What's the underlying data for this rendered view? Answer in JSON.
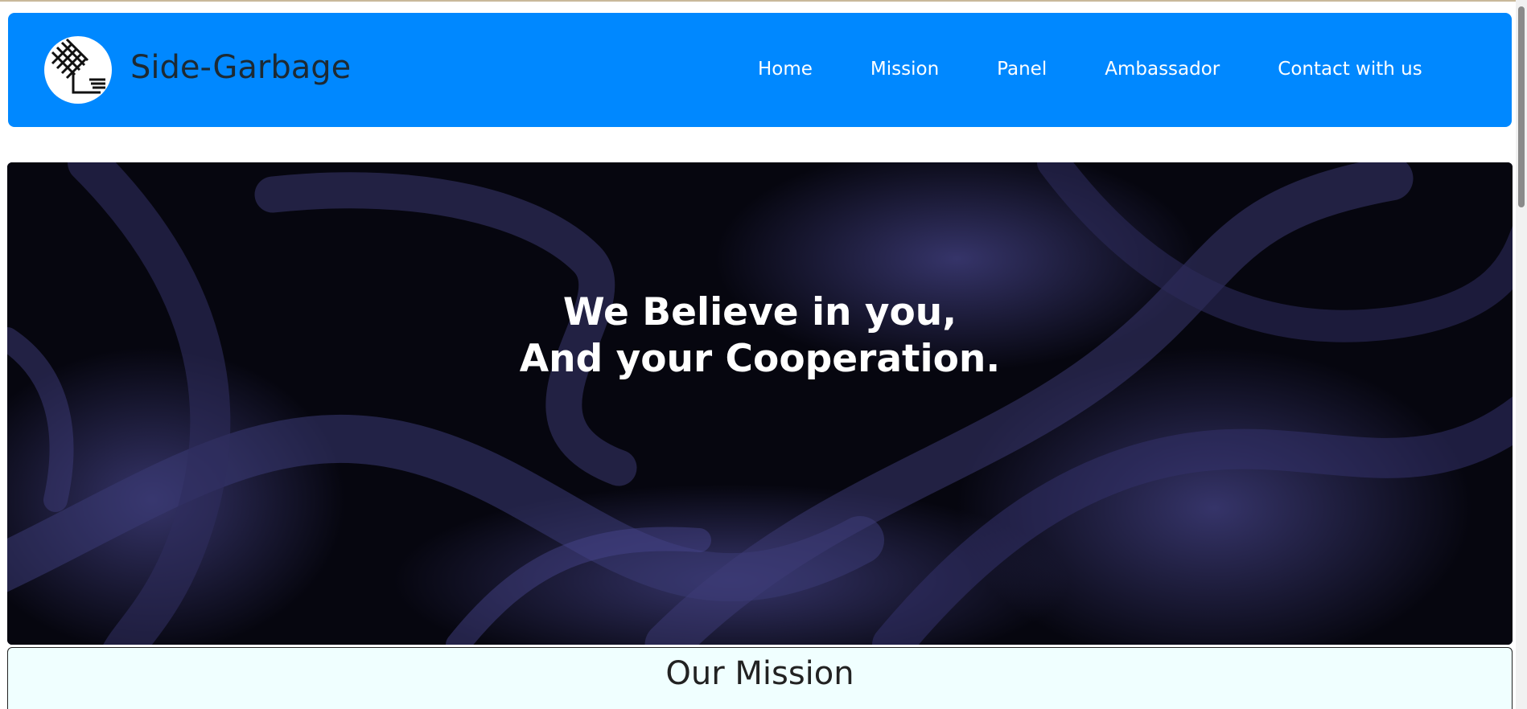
{
  "brand": {
    "name": "Side-Garbage"
  },
  "nav": {
    "items": [
      {
        "label": "Home"
      },
      {
        "label": "Mission"
      },
      {
        "label": "Panel"
      },
      {
        "label": "Ambassador"
      },
      {
        "label": "Contact with us"
      }
    ]
  },
  "hero": {
    "line1": "We Believe in you,",
    "line2": "And your Cooperation."
  },
  "mission": {
    "title": "Our Mission"
  },
  "colors": {
    "navbar": "#0088ff",
    "mission_bg": "#f0ffff",
    "hero_fabric": "#2a2a55"
  },
  "icons": {
    "logo": "knot-logo-icon"
  }
}
